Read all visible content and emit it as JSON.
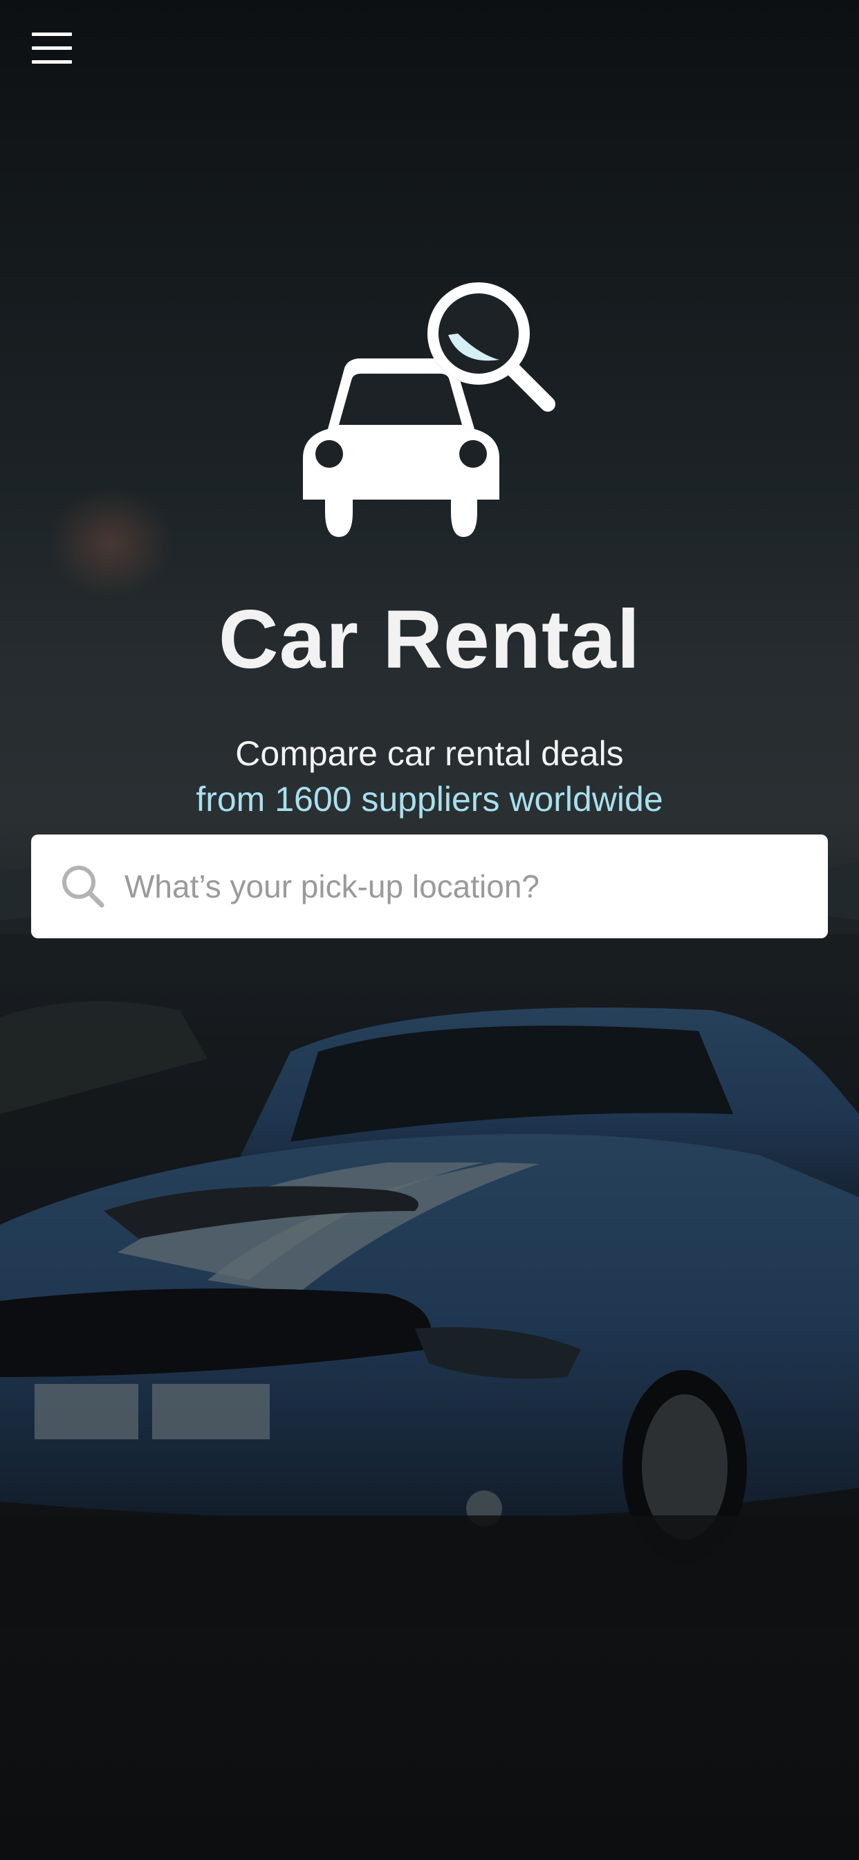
{
  "header": {
    "menu_icon": "hamburger-menu-icon"
  },
  "hero": {
    "logo_icon": "car-search-icon",
    "title": "Car Rental",
    "subtitle_line1": "Compare car rental deals",
    "subtitle_line2": "from 1600 suppliers worldwide"
  },
  "search": {
    "icon": "search-icon",
    "placeholder": "What’s your pick-up location?",
    "value": ""
  },
  "background": {
    "image": "blue sports car with white racing stripes on desert road"
  },
  "colors": {
    "accent_text": "#a9e0f0",
    "title_text": "#f2f2f2",
    "search_bg": "#ffffff",
    "placeholder_text": "#9a9a9a"
  }
}
